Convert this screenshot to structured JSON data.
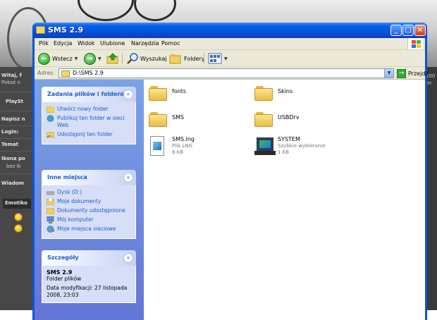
{
  "background": {
    "left_items": [
      "Witaj, f",
      "Pokaż n",
      "PlaySt",
      "Napisz n",
      "Login:",
      "Temat",
      "Ikona po",
      "bez ik",
      "Wiadom",
      "Emotiko"
    ],
    "right_items": [
      "200",
      "zn"
    ]
  },
  "window": {
    "title": "SMS 2.9",
    "controls": {
      "minimize": "_",
      "maximize": "□",
      "close": "×"
    }
  },
  "menu": [
    "Plik",
    "Edycja",
    "Widok",
    "Ulubione",
    "Narzędzia",
    "Pomoc"
  ],
  "toolbar": {
    "back": "Wstecz",
    "search": "Wyszukaj",
    "folders": "Foldery"
  },
  "address": {
    "label": "Adres",
    "value": "D:\\SMS 2.9",
    "go": "Przejdź"
  },
  "taskpane": {
    "file_tasks": {
      "title": "Zadania plików i folderów",
      "items": [
        "Utwórz nowy folder",
        "Publikuj ten folder w sieci Web",
        "Udostępnij ten folder"
      ]
    },
    "other_places": {
      "title": "Inne miejsca",
      "items": [
        "Dysk (D:)",
        "Moje dokumenty",
        "Dokumenty udostępnione",
        "Mój komputer",
        "Moje miejsca sieciowe"
      ]
    },
    "details": {
      "title": "Szczegóły",
      "name": "SMS 2.9",
      "type": "Folder plików",
      "modified": "Data modyfikacji: 27 listopada 2008, 23:03"
    }
  },
  "files": [
    {
      "name": "fonts",
      "kind": "folder"
    },
    {
      "name": "Skins",
      "kind": "folder"
    },
    {
      "name": "SMS",
      "kind": "folder"
    },
    {
      "name": "USBDrv",
      "kind": "folder"
    },
    {
      "name": "SMS.lng",
      "kind": "document",
      "type": "Plik LNG",
      "size": "6 KB"
    },
    {
      "name": "SYSTEM",
      "kind": "shortcut",
      "type": "Szybkie wybieranie",
      "size": "1 KB"
    }
  ]
}
